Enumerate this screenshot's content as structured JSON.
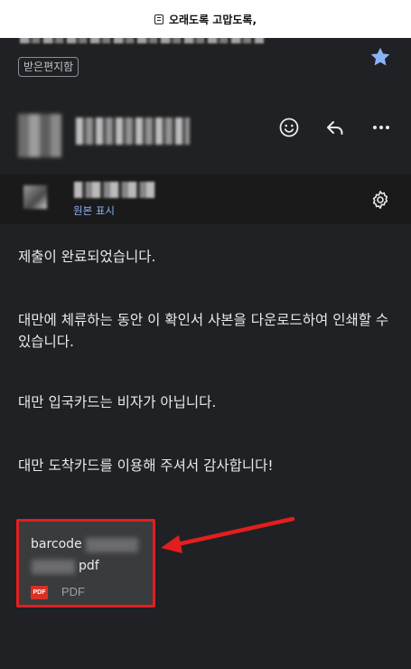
{
  "topbar": {
    "title": "오래도록 고맙도록,"
  },
  "header": {
    "label_chip": "받은편지함"
  },
  "recipient": {
    "show_original_link": "원본 표시"
  },
  "message": {
    "p1": "제출이 완료되었습니다.",
    "p2": "대만에 체류하는 동안 이 확인서 사본을 다운로드하여 인쇄할 수 있습니다.",
    "p3": "대만 입국카드는 비자가 아닙니다.",
    "p4": "대만 도착카드를 이용해 주셔서 감사합니다!"
  },
  "attachment": {
    "name_prefix": "barcode",
    "name_suffix": "pdf",
    "badge": "PDF",
    "type": "PDF"
  },
  "icons": {
    "star": "star-icon",
    "emoji": "smiley-icon",
    "reply": "reply-icon",
    "more": "more-icon",
    "settings": "gear-icon",
    "pdf": "pdf-icon"
  },
  "colors": {
    "background": "#202124",
    "star": "#8ab4f8",
    "link": "#8ab4f8",
    "highlight": "#e31e1e",
    "pdf_badge": "#d93025"
  }
}
